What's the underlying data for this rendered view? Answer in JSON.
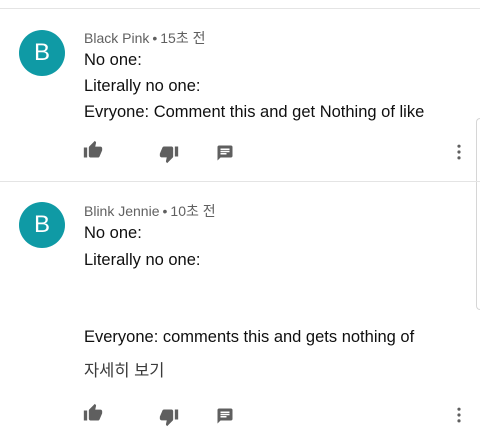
{
  "comments": [
    {
      "avatar_letter": "B",
      "author": "Black Pink",
      "separator": "•",
      "time": "15초 전",
      "lines": [
        "No one:",
        "Literally no one:",
        "Evryone: Comment this and get Nothing of like"
      ],
      "actions": [
        "thumb-up-icon",
        "thumb-down-icon",
        "reply-icon",
        "more-vert-icon"
      ]
    },
    {
      "avatar_letter": "B",
      "author": "Blink Jennie",
      "separator": "•",
      "time": "10초 전",
      "lines": [
        "No one:",
        "Literally no one:",
        "Everyone: comments this and gets nothing of"
      ],
      "read_more": "자세히 보기",
      "actions": [
        "thumb-up-icon",
        "thumb-down-icon",
        "reply-icon",
        "more-vert-icon"
      ]
    }
  ],
  "colors": {
    "avatar": "#0f9aa5",
    "meta_text": "#606060",
    "icon": "#5f5f5f",
    "divider": "#e4e4e4"
  }
}
